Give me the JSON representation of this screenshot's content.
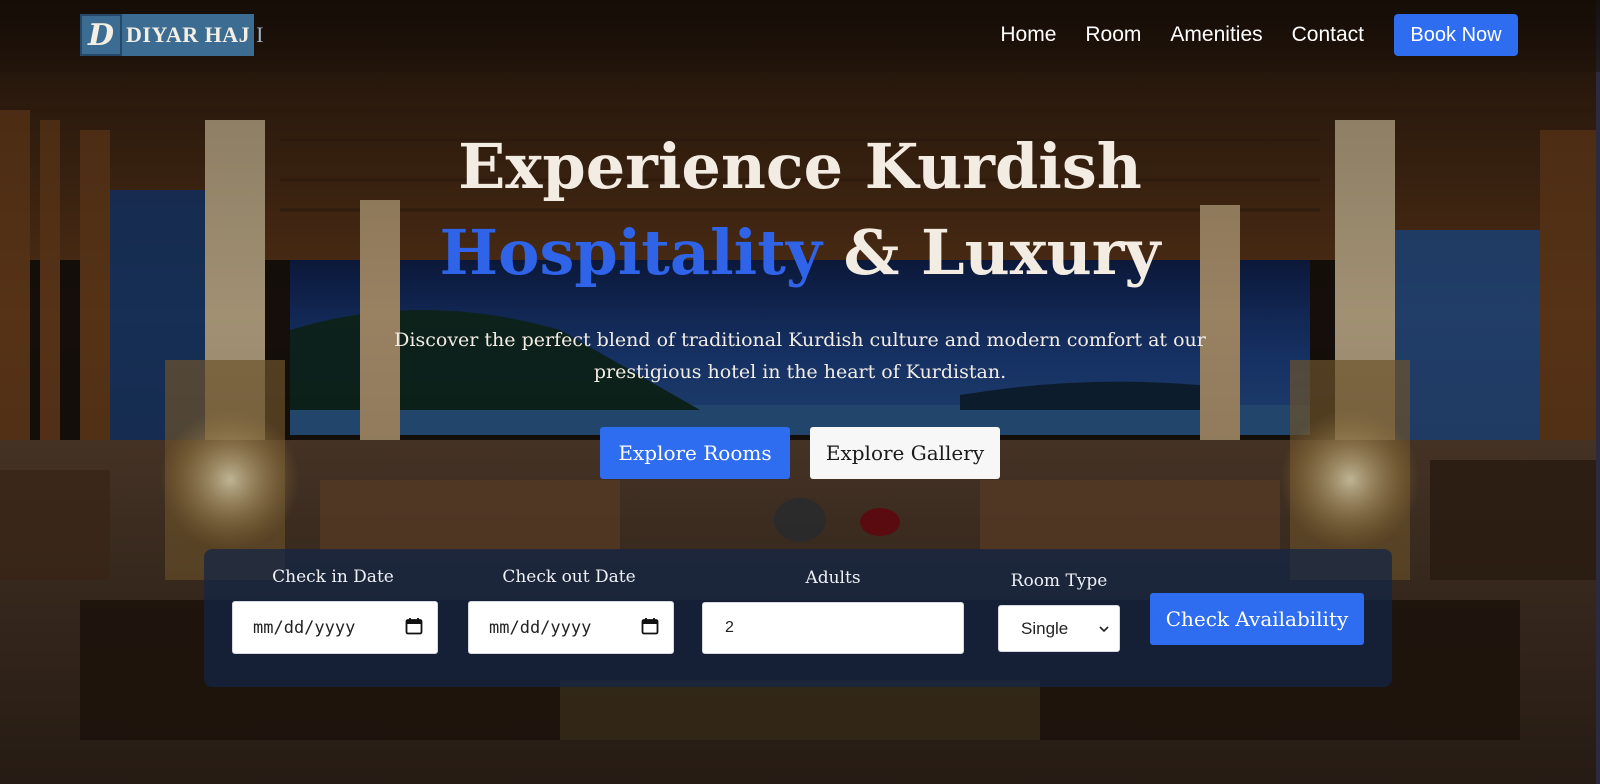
{
  "brand": {
    "logo_letter": "D",
    "name": "DIYAR HAJ",
    "name_tail": "I"
  },
  "nav": {
    "links": [
      "Home",
      "Room",
      "Amenities",
      "Contact"
    ],
    "cta": "Book Now"
  },
  "hero": {
    "title_line1": "Experience Kurdish",
    "title_accent": "Hospitality",
    "title_rest": " & Luxury",
    "subtitle": "Discover the perfect blend of traditional Kurdish culture and modern comfort at our prestigious hotel in the heart of Kurdistan.",
    "primary_button": "Explore Rooms",
    "secondary_button": "Explore Gallery"
  },
  "booking": {
    "check_in": {
      "label": "Check in Date",
      "placeholder": "mm/dd/yyyy"
    },
    "check_out": {
      "label": "Check out Date",
      "placeholder": "mm/dd/yyyy"
    },
    "adults": {
      "label": "Adults",
      "value": "2"
    },
    "room_type": {
      "label": "Room Type",
      "selected": "Single"
    },
    "submit": "Check Availability"
  },
  "colors": {
    "accent": "#2e6cf0",
    "title_accent": "#2f63e8",
    "logo_bg": "#3d6c93",
    "booking_bg": "#122646"
  },
  "icons": {
    "calendar": "calendar-icon",
    "dropdown": "chevron-down-icon"
  }
}
